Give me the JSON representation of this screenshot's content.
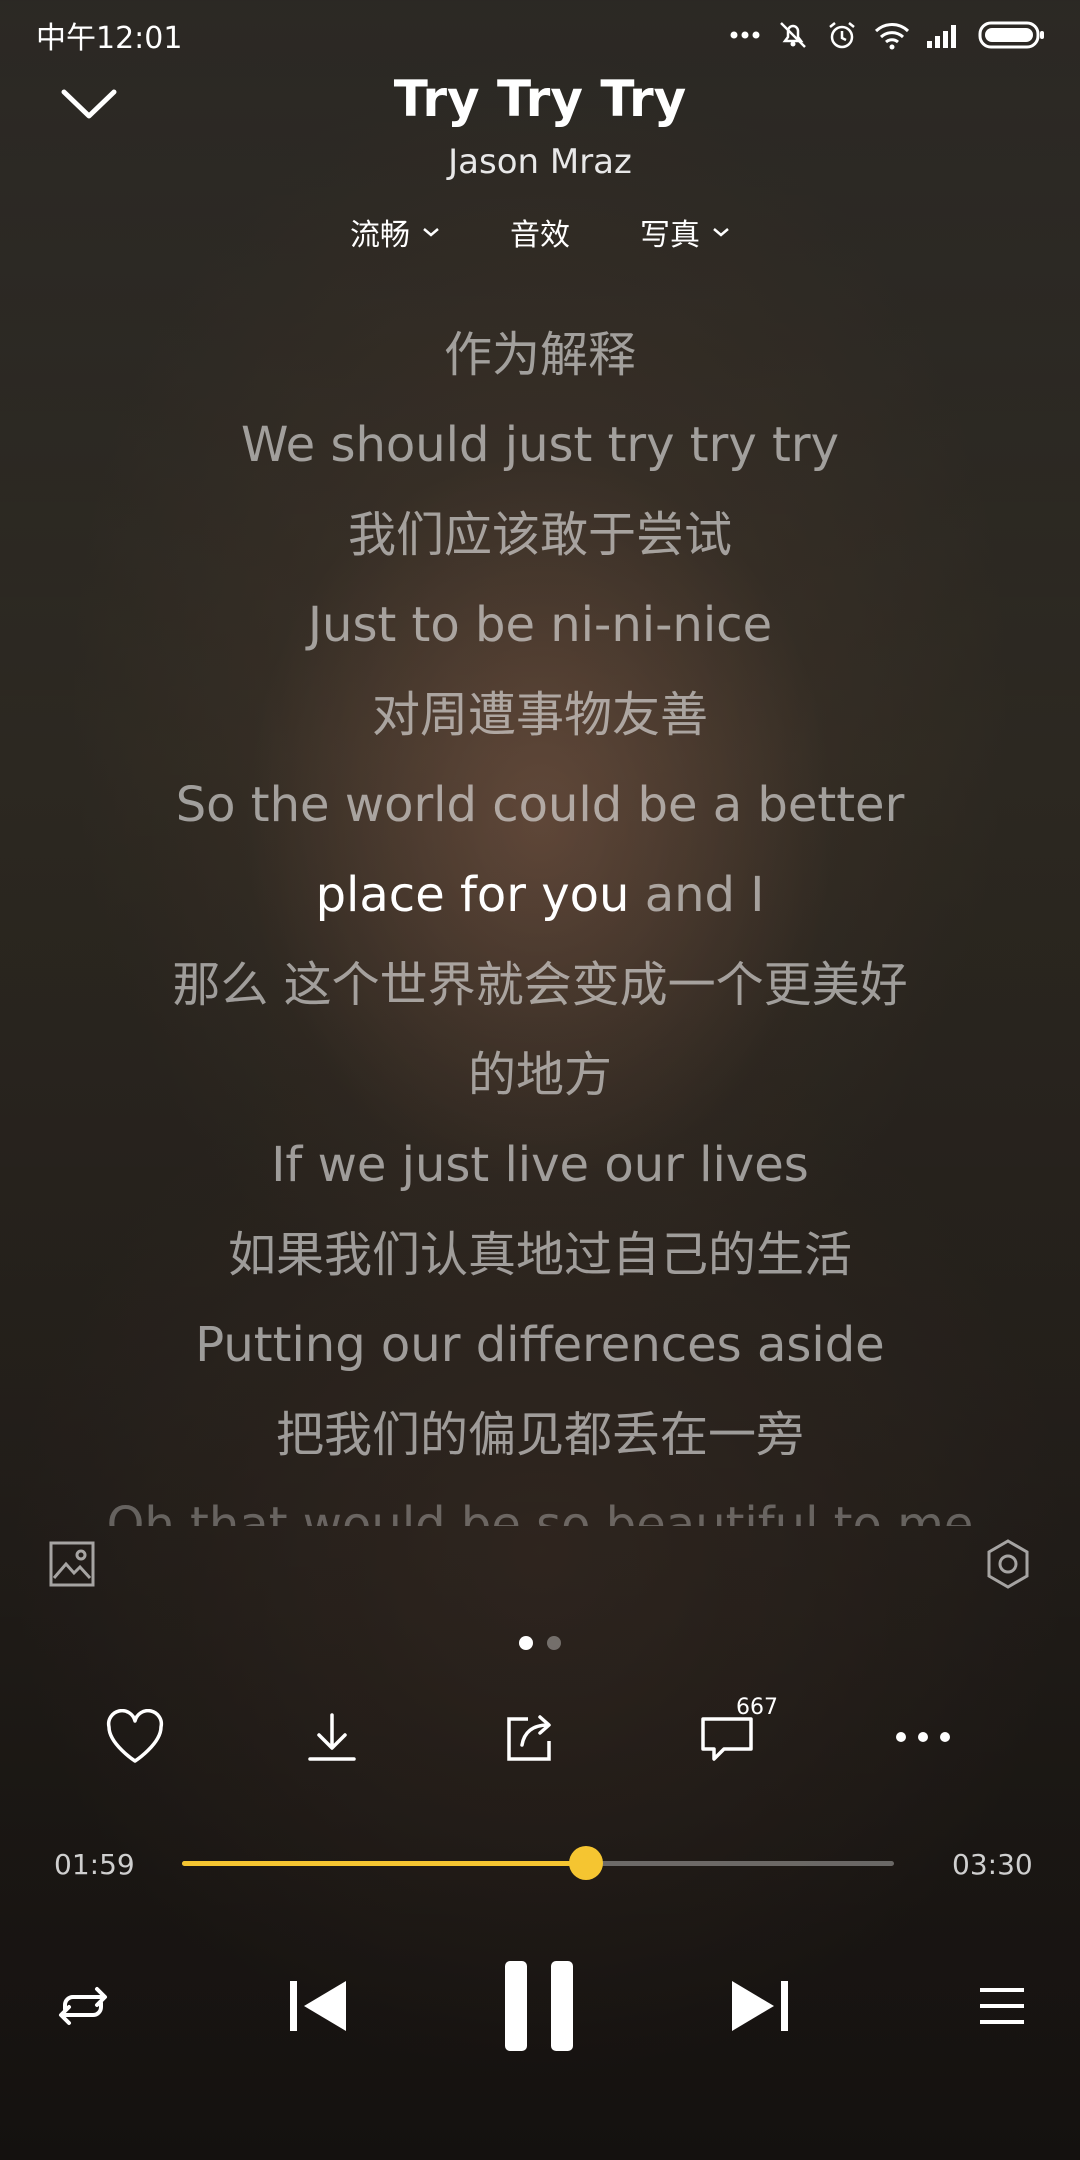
{
  "status_bar": {
    "time": "中午12:01",
    "icons": [
      "more-dots-icon",
      "mute-vibrate-icon",
      "alarm-icon",
      "wifi-icon",
      "signal-icon",
      "battery-icon"
    ]
  },
  "header": {
    "title": "Try Try Try",
    "artist": "Jason Mraz",
    "options": [
      {
        "label": "流畅",
        "has_dropdown": true
      },
      {
        "label": "音效",
        "has_dropdown": false
      },
      {
        "label": "写真",
        "has_dropdown": true
      }
    ]
  },
  "lyrics": {
    "lines": [
      "作为解释",
      "We should just try try try",
      "我们应该敢于尝试",
      "Just to be ni-ni-nice",
      "对周遭事物友善",
      "So the world could be a better",
      "那么 这个世界就会变成一个更美好",
      "的地方",
      "If we just live our lives",
      "如果我们认真地过自己的生活",
      "Putting our differences aside",
      "把我们的偏见都丢在一旁",
      "Oh that would be so beautiful to me"
    ],
    "active_sung": "place for you",
    "active_rest": " and I"
  },
  "pager": {
    "pages": 2,
    "current": 1
  },
  "actions": {
    "comment_count": "667",
    "icons": [
      "heart-icon",
      "download-icon",
      "share-icon",
      "comment-icon",
      "more-icon"
    ]
  },
  "progress": {
    "elapsed": "01:59",
    "total": "03:30",
    "fraction": 0.567
  },
  "colors": {
    "accent": "#f5c531",
    "text": "#ffffff",
    "lyric_dim": "#b9b6b1"
  }
}
